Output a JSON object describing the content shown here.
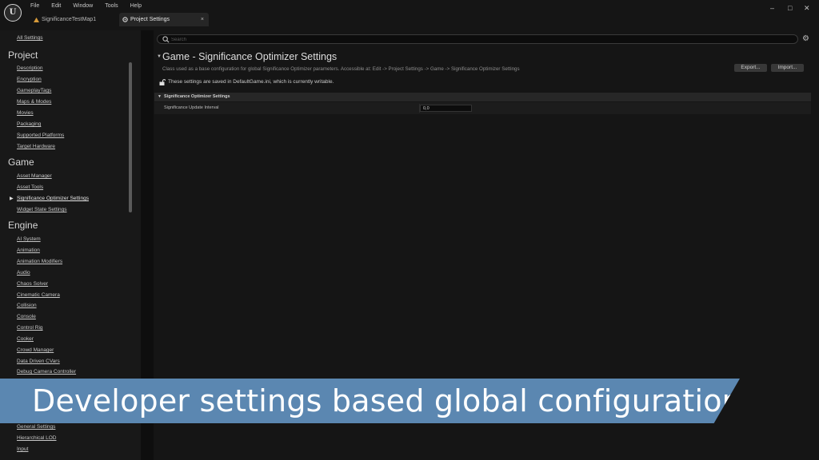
{
  "menu": [
    "File",
    "Edit",
    "Window",
    "Tools",
    "Help"
  ],
  "tabs": {
    "map": "SignificanceTestMap1",
    "settings": "Project Settings",
    "close": "×"
  },
  "window_controls": {
    "minimize": "–",
    "maximize": "□",
    "close": "✕"
  },
  "sidebar": {
    "all_settings": "All Settings",
    "project": {
      "heading": "Project",
      "items": [
        "Description",
        "Encryption",
        "GameplayTags",
        "Maps & Modes",
        "Movies",
        "Packaging",
        "Supported Platforms",
        "Target Hardware"
      ]
    },
    "game": {
      "heading": "Game",
      "items": [
        "Asset Manager",
        "Asset Tools",
        "Significance Optimizer Settings",
        "Widget State Settings"
      ],
      "selected_index": 2
    },
    "engine": {
      "heading": "Engine",
      "items": [
        "AI System",
        "Animation",
        "Animation Modifiers",
        "Audio",
        "Chaos Solver",
        "Cinematic Camera",
        "Collision",
        "Console",
        "Control Rig",
        "Cooker",
        "Crowd Manager",
        "Data Driven CVars",
        "Debug Camera Controller"
      ],
      "items_below": [
        "General Settings",
        "Hierarchical LOD",
        "Input"
      ]
    }
  },
  "search": {
    "placeholder": "Search"
  },
  "main": {
    "title": "Game - Significance Optimizer Settings",
    "description": "Class used as a base configuration for global Significance Optimizer parameters. Accessible at: Edit -> Project Settings -> Game -> Significance Optimizer Settings",
    "export_label": "Export...",
    "import_label": "Import...",
    "saved_note": "These settings are saved in DefaultGame.ini, which is currently writable.",
    "section": {
      "title": "Significance Optimizer Settings",
      "properties": [
        {
          "label": "Significance Update Interval",
          "value": "0,0"
        }
      ]
    }
  },
  "banner": {
    "text": "Developer settings based global configuration"
  },
  "colors": {
    "banner": "#5b87b1",
    "background": "#151515",
    "sidebar": "#181818"
  },
  "icons": [
    "unreal-logo-icon",
    "level-map-icon",
    "settings-tab-icon",
    "search-icon",
    "gear-icon",
    "unlock-icon",
    "collapse-arrow-icon"
  ]
}
